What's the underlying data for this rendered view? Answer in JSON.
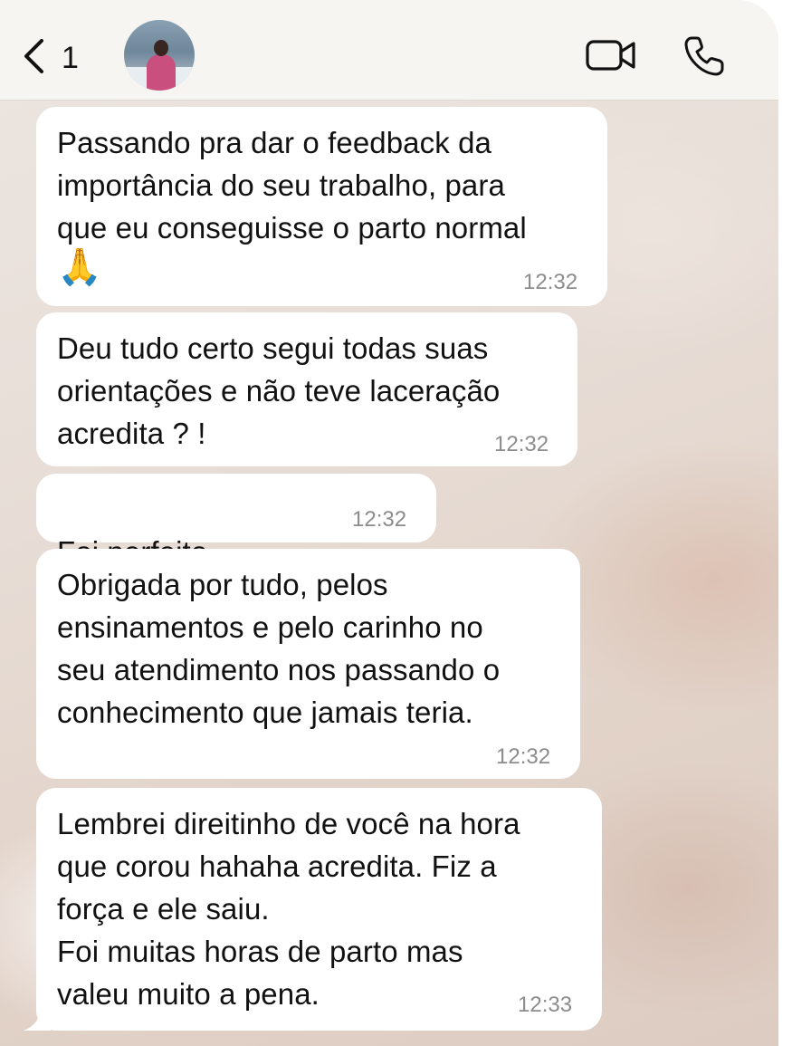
{
  "header": {
    "unread_count": "1",
    "avatar_alt": "contact-photo"
  },
  "messages": [
    {
      "text": "Passando pra dar o feedback da\nimportância do seu trabalho, para\nque eu conseguisse o parto normal",
      "emoji": "🙏",
      "time": "12:32"
    },
    {
      "text": "Deu tudo certo segui todas suas\norientações e não teve laceração\nacredita ? !",
      "time": "12:32"
    },
    {
      "text": "Foi perfeito",
      "emoji": "❤❤",
      "time": "12:32"
    },
    {
      "text": "Obrigada por tudo, pelos\nensinamentos e pelo carinho no\nseu atendimento nos passando o\nconhecimento que jamais teria.",
      "time": "12:32"
    },
    {
      "text": "Lembrei direitinho de você na hora\nque corou hahaha acredita. Fiz a\nforça e ele saiu.\nFoi muitas horas de parto mas\nvaleu muito a pena.",
      "time": "12:33"
    }
  ],
  "icons": {
    "back": "chevron-left-icon",
    "video": "video-camera-icon",
    "call": "phone-icon"
  }
}
